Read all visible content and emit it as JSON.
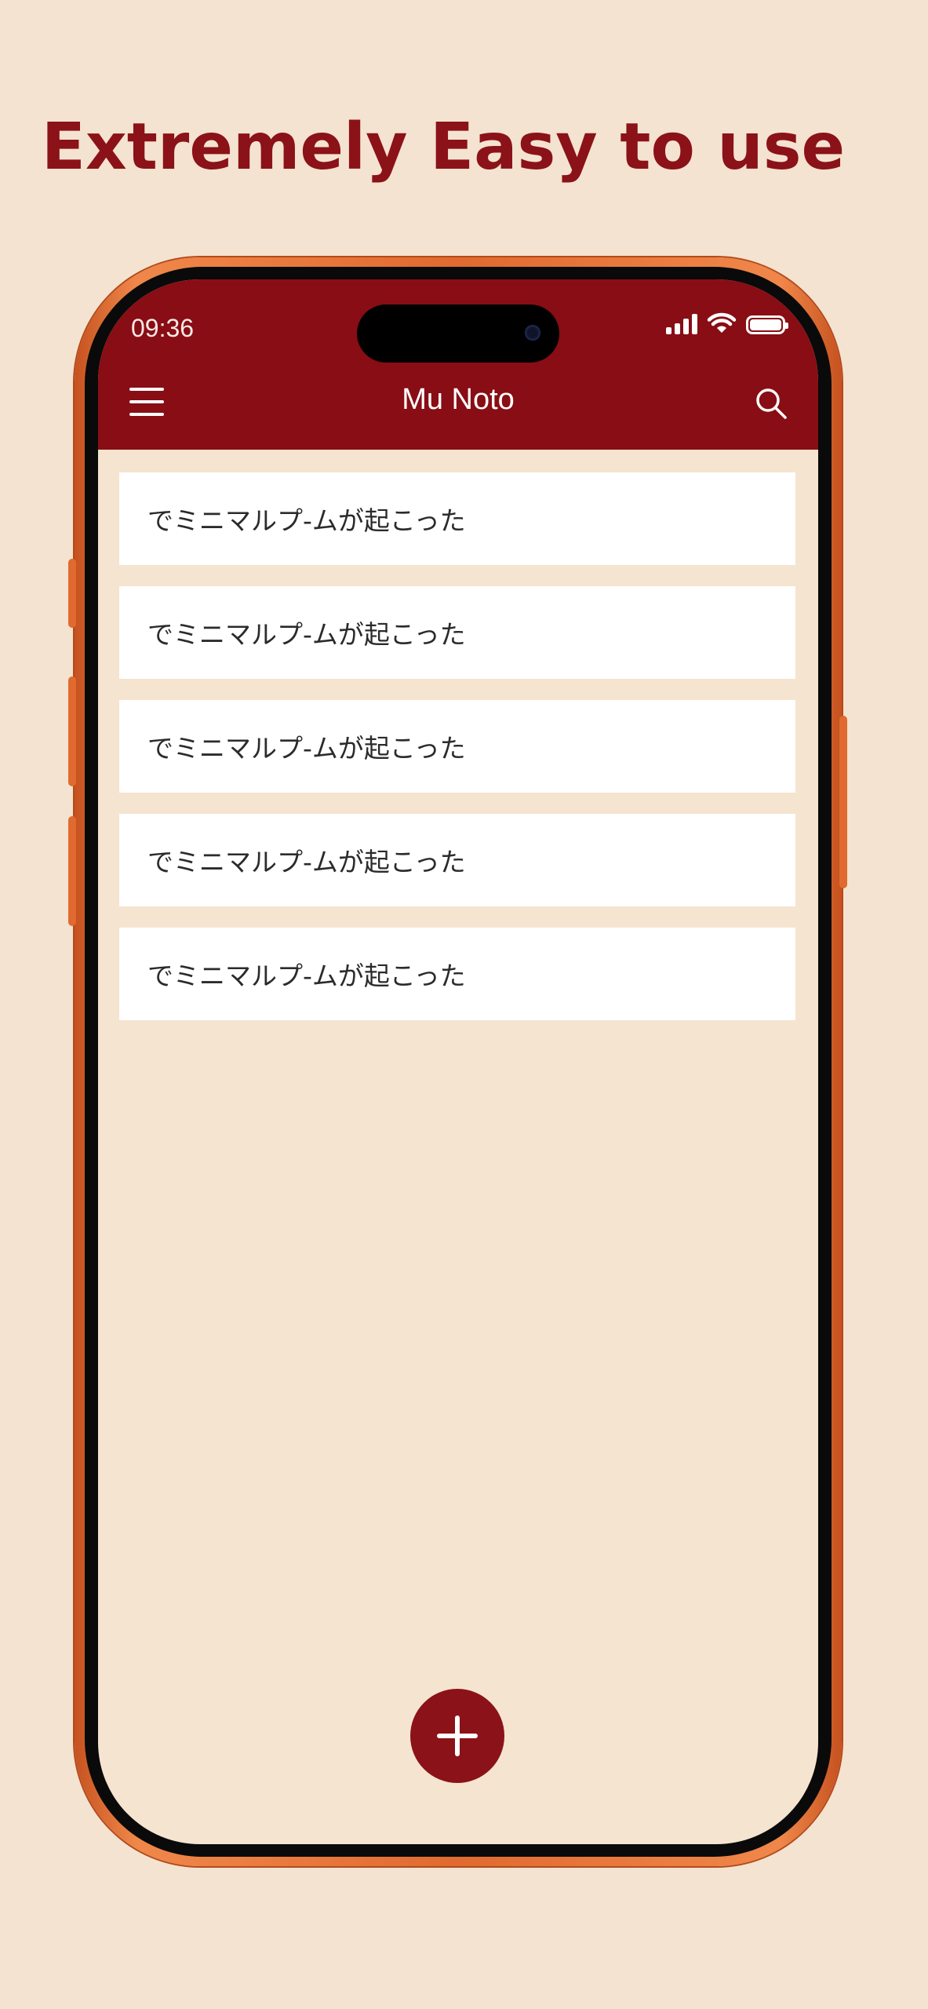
{
  "headline": "Extremely Easy to use",
  "status_bar": {
    "time": "09:36",
    "icons": [
      "cellular-signal-icon",
      "wifi-icon",
      "battery-icon"
    ],
    "battery_level": 1.0
  },
  "app_bar": {
    "title": "Mu Noto",
    "left_icon": "hamburger-menu-icon",
    "right_icon": "search-icon",
    "color": "#890d14"
  },
  "notes": [
    {
      "title": "でミニマルプ-ムが起こった"
    },
    {
      "title": "でミニマルプ-ムが起こった"
    },
    {
      "title": "でミニマルプ-ムが起こった"
    },
    {
      "title": "でミニマルプ-ムが起こった"
    },
    {
      "title": "でミニマルプ-ムが起こった"
    }
  ],
  "fab": {
    "icon": "plus-icon",
    "color": "#8b1218"
  },
  "colors": {
    "background": "#f4e3d0",
    "accent": "#8b1218",
    "phone_frame": "#e06a2f"
  }
}
